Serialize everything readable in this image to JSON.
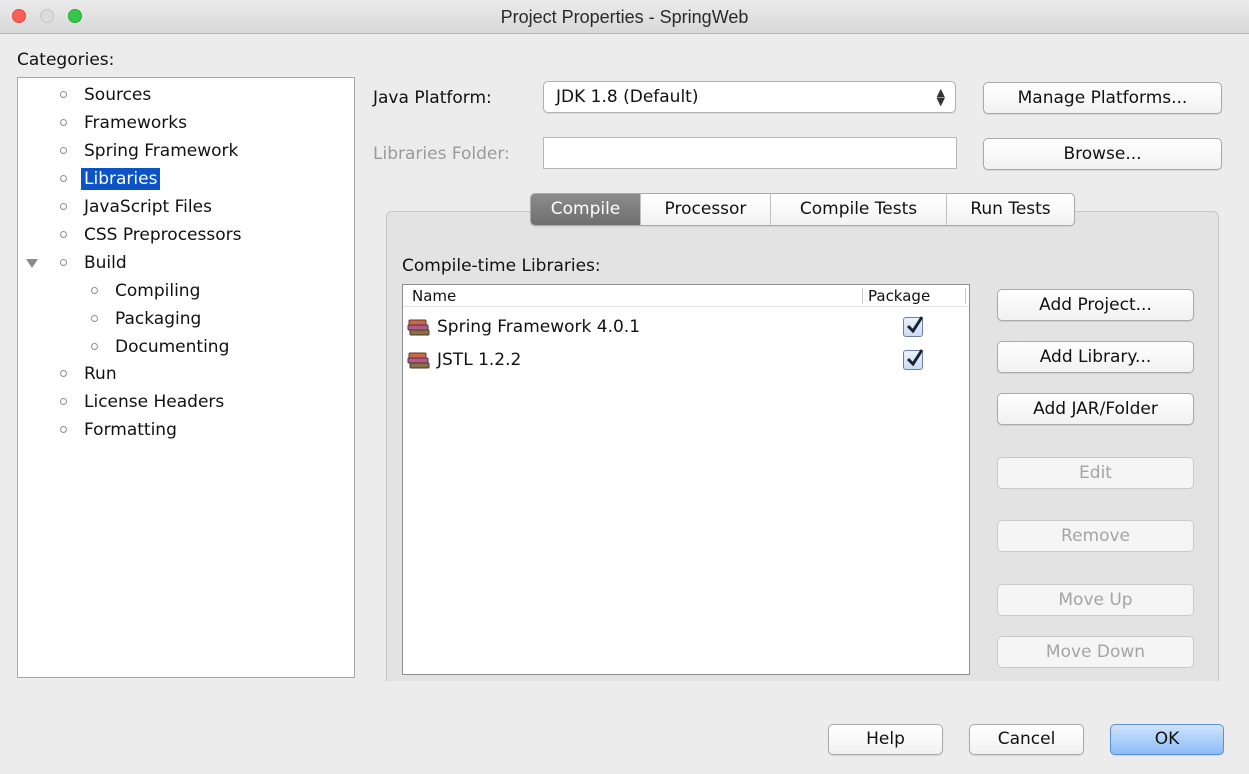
{
  "window": {
    "title": "Project Properties - SpringWeb"
  },
  "categories": {
    "label": "Categories:",
    "items": [
      {
        "label": "Sources"
      },
      {
        "label": "Frameworks"
      },
      {
        "label": "Spring Framework"
      },
      {
        "label": "Libraries",
        "selected": true
      },
      {
        "label": "JavaScript Files"
      },
      {
        "label": "CSS Preprocessors"
      },
      {
        "label": "Build",
        "expanded": true
      },
      {
        "label": "Compiling"
      },
      {
        "label": "Packaging"
      },
      {
        "label": "Documenting"
      },
      {
        "label": "Run"
      },
      {
        "label": "License Headers"
      },
      {
        "label": "Formatting"
      }
    ]
  },
  "form": {
    "java_platform_label": "Java Platform:",
    "java_platform_value": "JDK 1.8 (Default)",
    "manage_platforms_label": "Manage Platforms...",
    "libraries_folder_label": "Libraries Folder:",
    "libraries_folder_value": "",
    "browse_label": "Browse..."
  },
  "tabs": [
    {
      "label": "Compile",
      "active": true
    },
    {
      "label": "Processor"
    },
    {
      "label": "Compile Tests"
    },
    {
      "label": "Run Tests"
    }
  ],
  "compile": {
    "section_title": "Compile-time Libraries:",
    "columns": {
      "name": "Name",
      "package": "Package"
    },
    "rows": [
      {
        "name": "Spring Framework 4.0.1",
        "package": true
      },
      {
        "name": "JSTL 1.2.2",
        "package": true
      }
    ],
    "buttons": {
      "add_project": "Add Project...",
      "add_library": "Add Library...",
      "add_jar": "Add JAR/Folder",
      "edit": "Edit",
      "remove": "Remove",
      "move_up": "Move Up",
      "move_down": "Move Down"
    }
  },
  "footer": {
    "help": "Help",
    "cancel": "Cancel",
    "ok": "OK"
  },
  "colors": {
    "selection": "#0b53c7",
    "default_button": "#8cbbf6",
    "close": "#fc5f57",
    "maximize": "#34c84a"
  }
}
